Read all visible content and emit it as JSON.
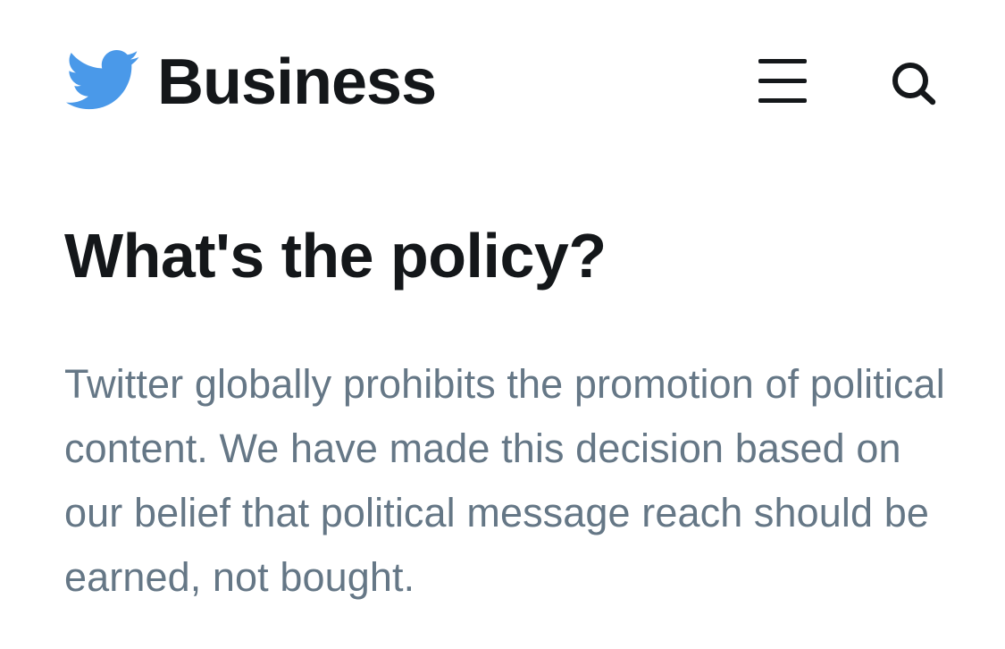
{
  "header": {
    "brand": "Business",
    "logo_icon": "twitter-bird-icon",
    "menu_icon": "hamburger-menu-icon",
    "search_icon": "search-icon",
    "colors": {
      "brand_blue": "#4a99e9",
      "text_dark": "#14171a"
    }
  },
  "main": {
    "heading": "What's the policy?",
    "paragraph": "Twitter globally prohibits the promotion of political content. We have made this decision based on our belief that political message reach should be earned, not bought.",
    "colors": {
      "paragraph_text": "#657786"
    }
  }
}
